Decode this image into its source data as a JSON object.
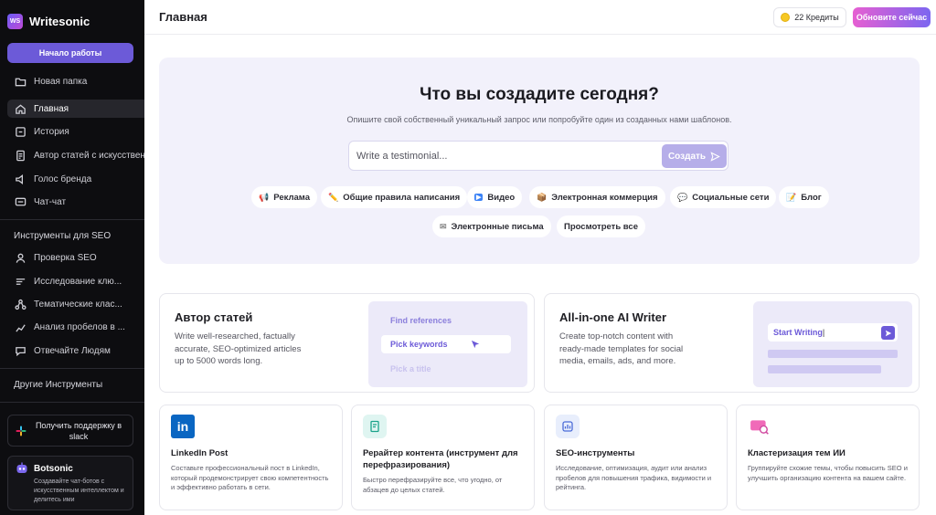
{
  "sidebar": {
    "brand": "Writesonic",
    "logo_text": "WS",
    "start_button": "Начало работы",
    "items": [
      {
        "label": "Новая папка",
        "icon": "folder-icon"
      },
      {
        "label": "Главная",
        "icon": "home-icon",
        "active": true
      },
      {
        "label": "История",
        "icon": "history-icon"
      },
      {
        "label": "Автор статей с искусственным интеллектом",
        "icon": "document-icon"
      },
      {
        "label": "Голос бренда",
        "icon": "brand-voice-icon"
      },
      {
        "label": "Чат-чат",
        "icon": "chat-icon"
      }
    ],
    "seo_section": "Инструменты для SEO",
    "seo_items": [
      {
        "label": "Проверка SEO",
        "icon": "seo-check-icon"
      },
      {
        "label": "Исследование клю...",
        "icon": "keyword-icon"
      },
      {
        "label": "Тематические клас...",
        "icon": "cluster-icon"
      },
      {
        "label": "Анализ пробелов в ...",
        "icon": "gap-analysis-icon"
      },
      {
        "label": "Отвечайте Людям",
        "icon": "answer-icon"
      }
    ],
    "other_section": "Другие Инструменты",
    "support_label": "Получить поддержку в slack",
    "botsonic": {
      "name": "Botsonic",
      "description": "Создавайте чат-ботов с искусственным интеллектом и делитесь ими"
    }
  },
  "header": {
    "title": "Главная",
    "credits": "22 Кредиты",
    "upgrade_button": "Обновите сейчас"
  },
  "hero": {
    "title": "Что вы создадите сегодня?",
    "subtitle": "Опишите свой собственный уникальный запрос или попробуйте один из созданных нами шаблонов.",
    "prompt_placeholder": "Write a testimonial...",
    "create_button": "Создать",
    "chips": [
      {
        "label": "Реклама",
        "icon": "📢"
      },
      {
        "label": "Общие правила написания",
        "icon": "✏️"
      },
      {
        "label": "Видео",
        "icon": "▶"
      },
      {
        "label": "Электронная коммерция",
        "icon": "📦"
      },
      {
        "label": "Социальные сети",
        "icon": "💬"
      },
      {
        "label": "Блог",
        "icon": "📝"
      },
      {
        "label": "Электронные письма",
        "icon": "✉"
      },
      {
        "label": "Просмотреть все",
        "icon": ""
      }
    ]
  },
  "features": [
    {
      "title": "Автор статей",
      "description": "Write well-researched, factually accurate, SEO-optimized articles up to 5000 words long.",
      "mock": [
        "Find references",
        "Pick keywords",
        "Pick a title"
      ]
    },
    {
      "title": "All-in-one AI Writer",
      "description": "Create top-notch content with ready-made templates for social media, emails, ads, and more.",
      "mock": [
        "Start Writing"
      ]
    }
  ],
  "tools": [
    {
      "title": "LinkedIn Post",
      "description": "Составьте профессиональный пост в LinkedIn, который продемонстрирует свою компетентность и эффективно работать в сети.",
      "icon": "linkedin-icon",
      "icon_bg": "#0a66c2"
    },
    {
      "title": "Рерайтер контента (инструмент для перефразирования)",
      "description": "Быстро перефразируйте все, что угодно, от абзацев до целых статей.",
      "icon": "rewriter-icon",
      "icon_bg": "#dff5f1"
    },
    {
      "title": "SEO-инструменты",
      "description": "Исследование, оптимизация, аудит или анализ пробелов для повышения трафика, видимости и рейтинга.",
      "icon": "seo-tools-icon",
      "icon_bg": "#e8eefc"
    },
    {
      "title": "Кластеризация тем ИИ",
      "description": "Группируйте схожие темы, чтобы повысить SEO и улучшить организацию контента на вашем сайте.",
      "icon": "cluster-topics-icon",
      "icon_bg": "#fdeaf4"
    }
  ],
  "colors": {
    "accent": "#6c5ad8",
    "sidebar_bg": "#0d0d10",
    "hero_bg": "#f2f1fb"
  }
}
